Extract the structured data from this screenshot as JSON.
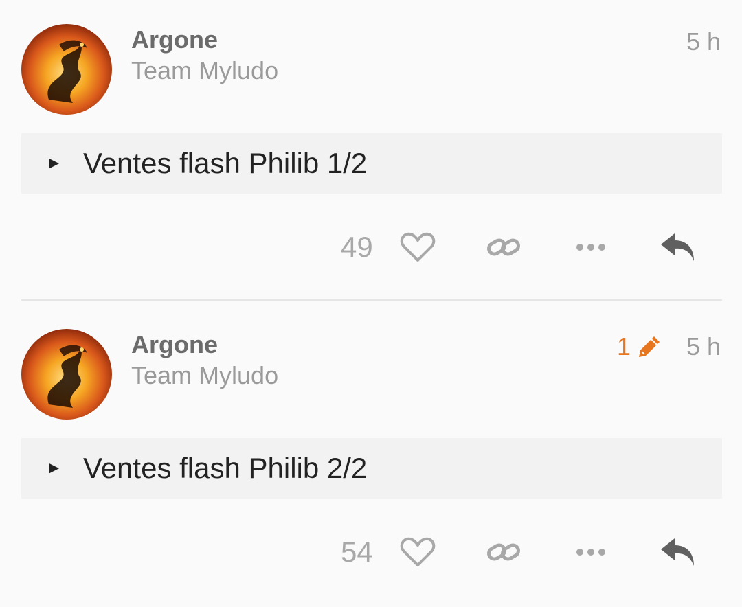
{
  "posts": [
    {
      "author": "Argone",
      "group": "Team Myludo",
      "time": "5 h",
      "summary": "Ventes flash Philib 1/2",
      "likes": "49",
      "edits": null
    },
    {
      "author": "Argone",
      "group": "Team Myludo",
      "time": "5 h",
      "summary": "Ventes flash Philib 2/2",
      "likes": "54",
      "edits": "1"
    }
  ],
  "colors": {
    "edit_accent": "#e8761f",
    "muted": "#9a9a9a",
    "author": "#6b6b6b",
    "details_bg": "#f2f2f2"
  },
  "icons": {
    "details_arrow": "►",
    "like": "heart-outline-icon",
    "link": "link-icon",
    "more": "ellipsis-icon",
    "reply": "reply-icon",
    "edit": "pencil-icon"
  }
}
